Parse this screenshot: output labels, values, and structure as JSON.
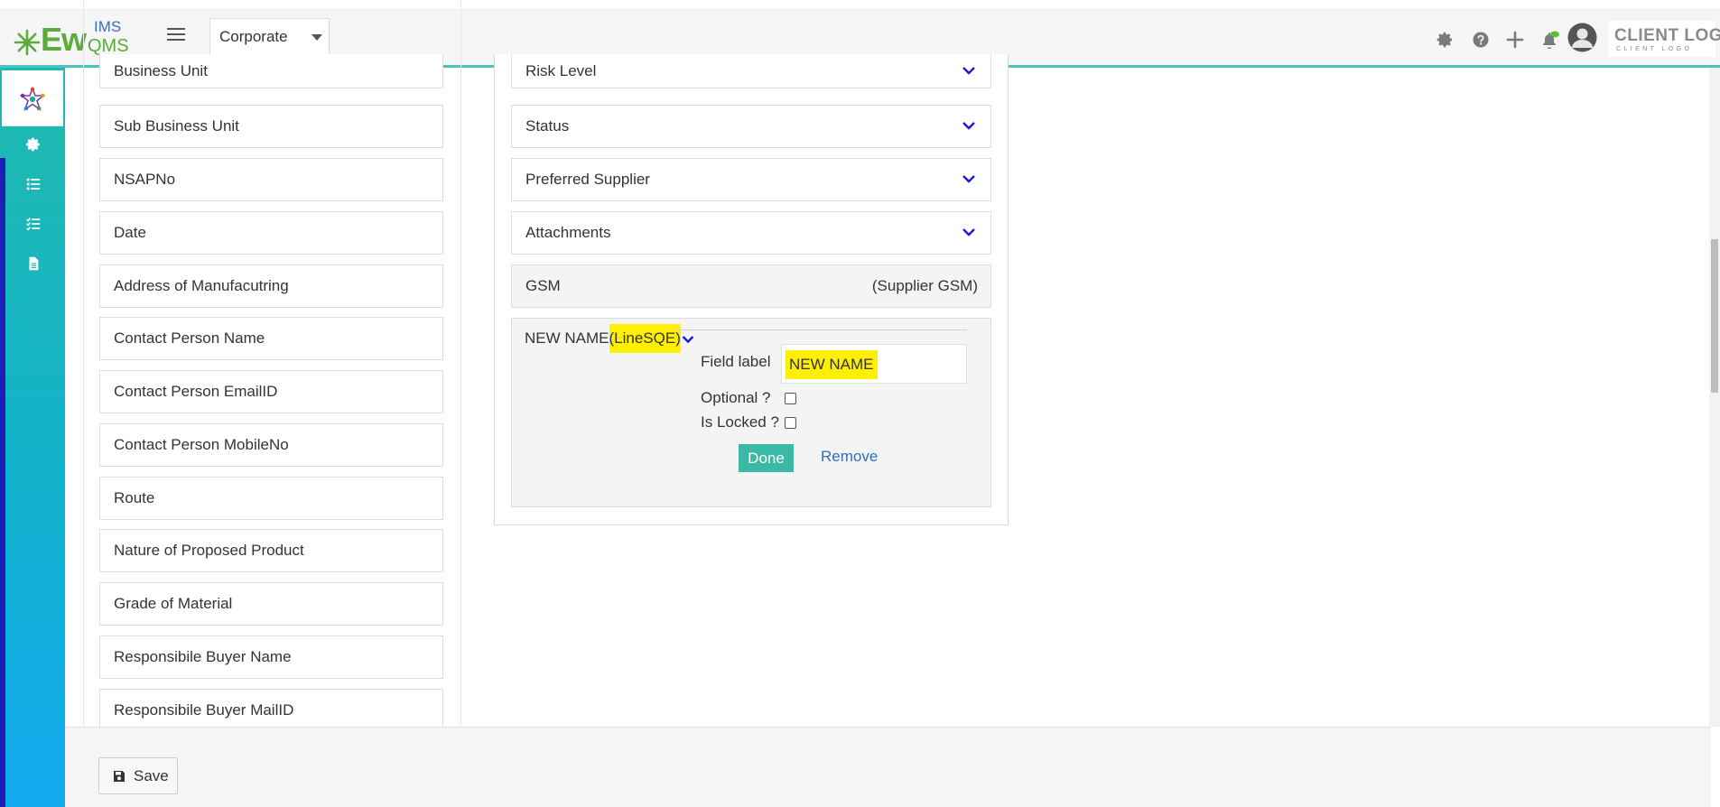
{
  "header": {
    "logo_ew": "Ew",
    "logo_ims": "IMS",
    "logo_qms": "QMS",
    "org_select_value": "Corporate",
    "client_logo_main": "CLIENT LOGO",
    "client_logo_sub": "CLIENT LOGO",
    "icons": [
      "settings-icon",
      "help-icon",
      "plus-icon",
      "bell-icon",
      "avatar"
    ]
  },
  "sidebar": {
    "icons": [
      "gear-icon",
      "list-icon",
      "checklist-icon",
      "document-icon"
    ]
  },
  "left_fields": [
    "Business Unit",
    "Sub Business Unit",
    "NSAPNo",
    "Date",
    "Address of Manufacutring",
    "Contact Person Name",
    "Contact Person EmailID",
    "Contact Person MobileNo",
    "Route",
    "Nature of Proposed Product",
    "Grade of Material",
    "Responsibile Buyer Name",
    "Responsibile Buyer MailID"
  ],
  "right_fields": [
    "Risk Level",
    "Status",
    "Preferred Supplier",
    "Attachments"
  ],
  "gsm": {
    "label": "GSM",
    "right_text": "(Supplier GSM)"
  },
  "new_field": {
    "name": "NEW NAME",
    "type_tag": "(LineSQE)",
    "field_label_text": "Field label",
    "field_label_value": "NEW NAME",
    "optional_text": "Optional ?",
    "locked_text": "Is Locked ?",
    "done_label": "Done",
    "remove_label": "Remove"
  },
  "footer": {
    "save_label": "Save"
  },
  "colors": {
    "accent_teal": "#3bb9a4",
    "header_border": "#4cc3bb",
    "highlight": "#ffef00",
    "link_blue": "#2f6fc0",
    "chevron_blue": "#1a1ad6"
  }
}
